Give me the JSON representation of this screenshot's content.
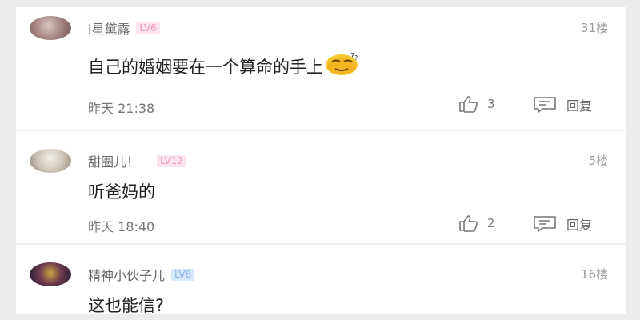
{
  "comments": [
    {
      "user": "i星黛露",
      "level": "LV6",
      "level_color": "#fbe3ef",
      "floor": "31楼",
      "text": "自己的婚姻要在一个算命的手上",
      "emoji": "thinking-face-emoji",
      "time": "昨天 21:38",
      "likes": "3",
      "reply_label": "回复"
    },
    {
      "user": "甜圈儿！",
      "level": "LV12",
      "level_color": "#fbe3ef",
      "floor": "5楼",
      "text": "听爸妈的",
      "time": "昨天 18:40",
      "likes": "2",
      "reply_label": "回复"
    },
    {
      "user": "精神小伙子儿",
      "level": "LV8",
      "level_color": "#d8e8fb",
      "floor": "16楼",
      "text": "这也能信?"
    }
  ]
}
